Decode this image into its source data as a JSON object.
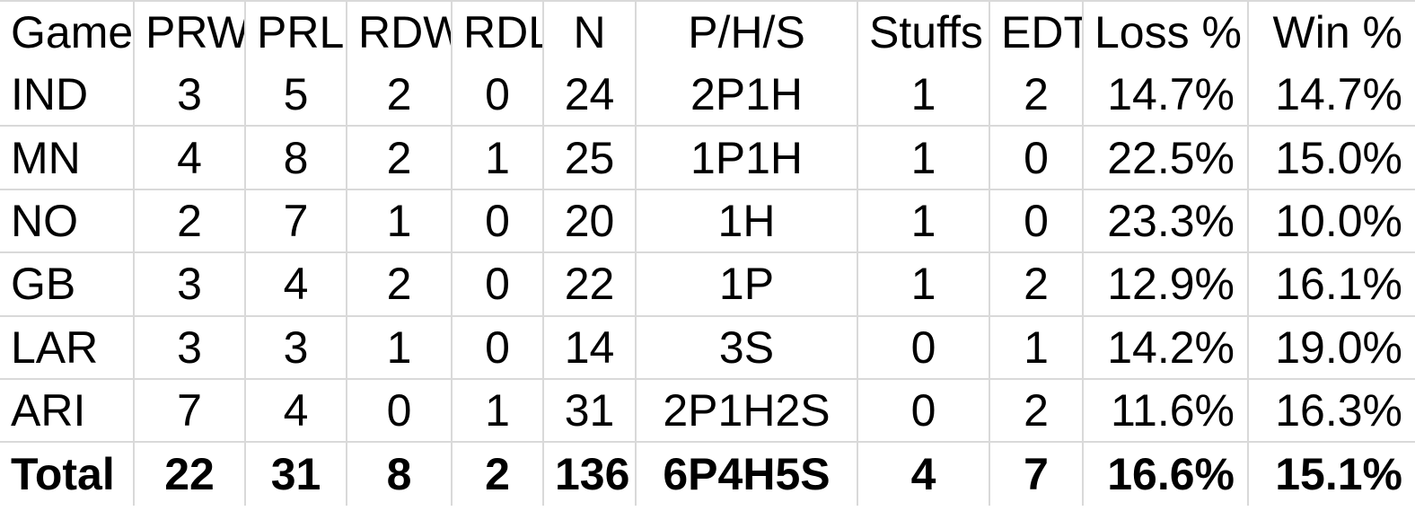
{
  "table": {
    "columns": [
      {
        "key": "game",
        "label": "Game",
        "align": "left",
        "type": "label"
      },
      {
        "key": "prw",
        "label": "PRW",
        "align": "center",
        "type": "num"
      },
      {
        "key": "prl",
        "label": "PRL",
        "align": "center",
        "type": "num"
      },
      {
        "key": "rdw",
        "label": "RDW",
        "align": "center",
        "type": "num"
      },
      {
        "key": "rdl",
        "label": "RDL",
        "align": "center",
        "type": "num"
      },
      {
        "key": "n",
        "label": "N",
        "align": "center",
        "type": "num"
      },
      {
        "key": "phs",
        "label": "P/H/S",
        "align": "center",
        "type": "num"
      },
      {
        "key": "stuffs",
        "label": "Stuffs",
        "align": "center",
        "type": "num"
      },
      {
        "key": "edt",
        "label": "EDT",
        "align": "center",
        "type": "num"
      },
      {
        "key": "loss",
        "label": "Loss %",
        "align": "right",
        "type": "pct"
      },
      {
        "key": "win",
        "label": "Win %",
        "align": "right",
        "type": "pct"
      }
    ],
    "rows": [
      {
        "game": "IND",
        "prw": "3",
        "prl": "5",
        "rdw": "2",
        "rdl": "0",
        "n": "24",
        "phs": "2P1H",
        "stuffs": "1",
        "edt": "2",
        "loss": "14.7%",
        "win": "14.7%",
        "total": false
      },
      {
        "game": "MN",
        "prw": "4",
        "prl": "8",
        "rdw": "2",
        "rdl": "1",
        "n": "25",
        "phs": "1P1H",
        "stuffs": "1",
        "edt": "0",
        "loss": "22.5%",
        "win": "15.0%",
        "total": false
      },
      {
        "game": "NO",
        "prw": "2",
        "prl": "7",
        "rdw": "1",
        "rdl": "0",
        "n": "20",
        "phs": "1H",
        "stuffs": "1",
        "edt": "0",
        "loss": "23.3%",
        "win": "10.0%",
        "total": false
      },
      {
        "game": "GB",
        "prw": "3",
        "prl": "4",
        "rdw": "2",
        "rdl": "0",
        "n": "22",
        "phs": "1P",
        "stuffs": "1",
        "edt": "2",
        "loss": "12.9%",
        "win": "16.1%",
        "total": false
      },
      {
        "game": "LAR",
        "prw": "3",
        "prl": "3",
        "rdw": "1",
        "rdl": "0",
        "n": "14",
        "phs": "3S",
        "stuffs": "0",
        "edt": "1",
        "loss": "14.2%",
        "win": "19.0%",
        "total": false
      },
      {
        "game": "ARI",
        "prw": "7",
        "prl": "4",
        "rdw": "0",
        "rdl": "1",
        "n": "31",
        "phs": "2P1H2S",
        "stuffs": "0",
        "edt": "2",
        "loss": "11.6%",
        "win": "16.3%",
        "total": false
      },
      {
        "game": "Total",
        "prw": "22",
        "prl": "31",
        "rdw": "8",
        "rdl": "2",
        "n": "136",
        "phs": "6P4H5S",
        "stuffs": "4",
        "edt": "7",
        "loss": "16.6%",
        "win": "15.1%",
        "total": true
      }
    ]
  },
  "style": {
    "grid_line_color": "#d9d9d9",
    "background_color": "#ffffff",
    "text_color": "#000000"
  }
}
